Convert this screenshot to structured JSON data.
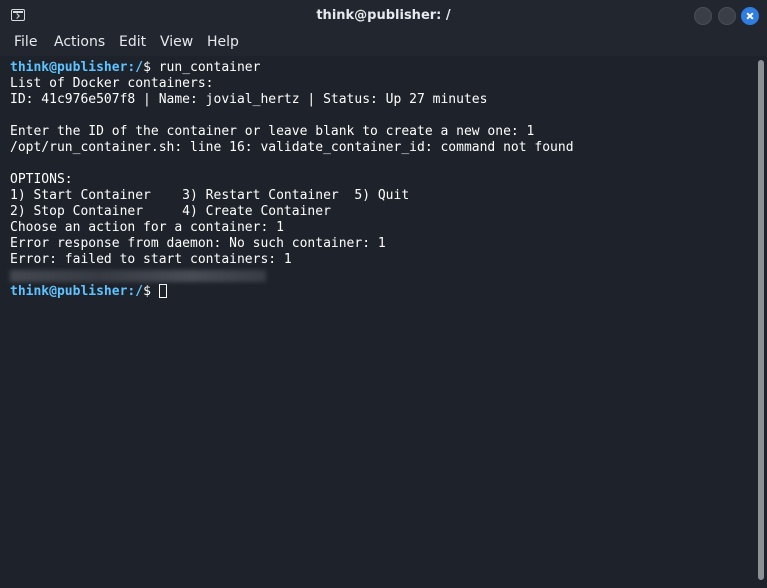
{
  "window": {
    "title": "think@publisher: /"
  },
  "menu": [
    "File",
    "Actions",
    "Edit",
    "View",
    "Help"
  ],
  "prompt": {
    "user": "think@publisher",
    "path": ":/",
    "symbol": "$ "
  },
  "terminal": {
    "command": "run_container",
    "lines": [
      "List of Docker containers:",
      "ID: 41c976e507f8 | Name: jovial_hertz | Status: Up 27 minutes",
      "",
      "Enter the ID of the container or leave blank to create a new one: 1",
      "/opt/run_container.sh: line 16: validate_container_id: command not found",
      "",
      "OPTIONS:",
      "1) Start Container    3) Restart Container  5) Quit",
      "2) Stop Container     4) Create Container",
      "Choose an action for a container: 1",
      "Error response from daemon: No such container: 1",
      "Error: failed to start containers: 1"
    ]
  },
  "icons": {
    "app": "terminal-icon",
    "minimize": "minimize-icon",
    "maximize": "maximize-icon",
    "close": "close-icon"
  }
}
